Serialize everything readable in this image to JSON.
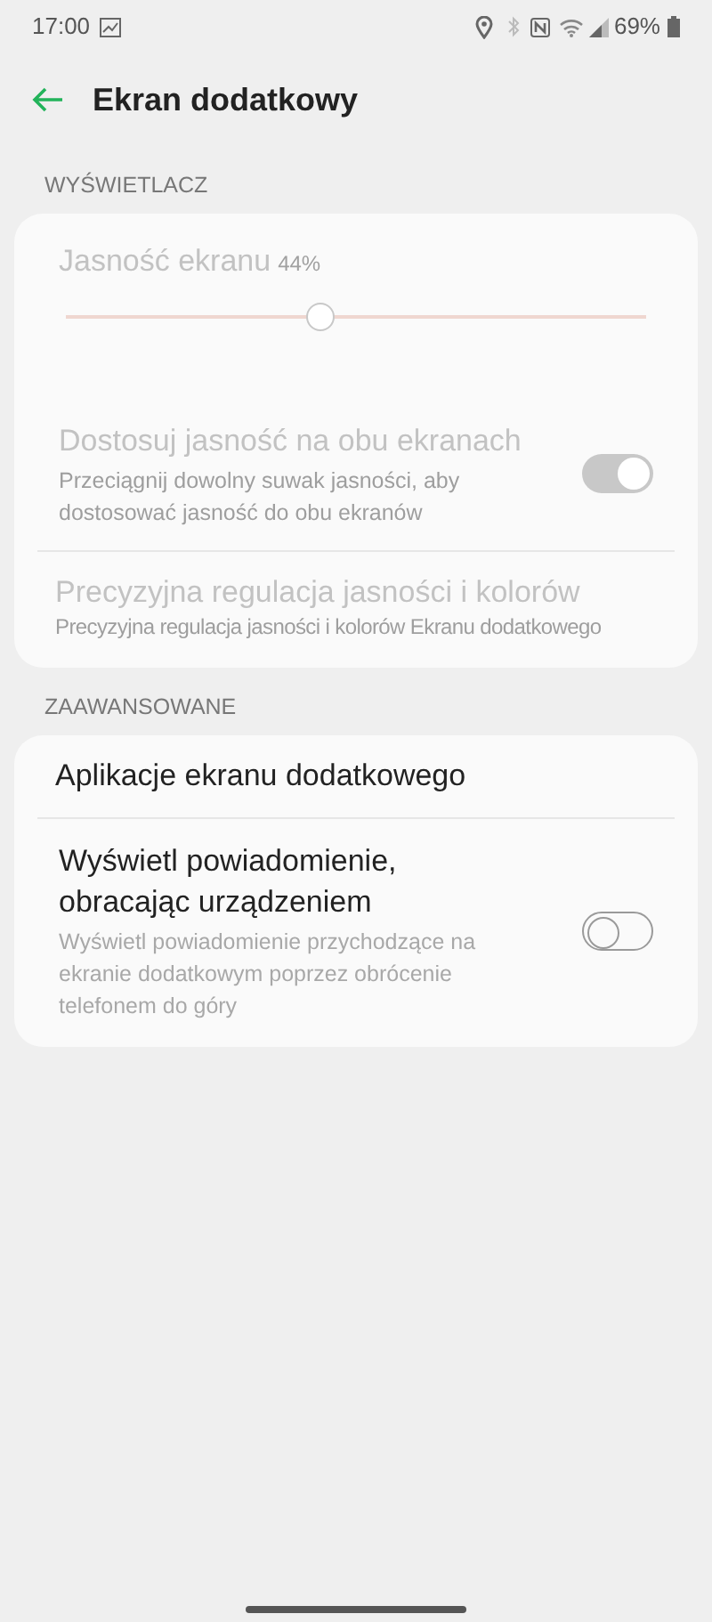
{
  "status_bar": {
    "time": "17:00",
    "battery": "69%"
  },
  "header": {
    "title": "Ekran dodatkowy"
  },
  "sections": [
    {
      "title": "WYŚWIETLACZ",
      "items": [
        {
          "kind": "slider",
          "label": "Jasność ekranu",
          "reading": "44%",
          "level": 0.44,
          "disabled": true
        },
        {
          "kind": "toggle",
          "label": "Dostosuj jasność na obu ekranach",
          "summary": "Przeciągnij dowolny suwak jasności, aby dostosować jasność do obu ekranów",
          "on": true,
          "disabled": true
        },
        {
          "kind": "link",
          "label": "Precyzyjna regulacja jasności i kolorów",
          "summary": "Precyzyjna regulacja jasności i kolorów Ekranu dodatkowego",
          "disabled": true
        }
      ]
    },
    {
      "title": "ZAAWANSOWANE",
      "items": [
        {
          "kind": "link",
          "label": "Aplikacje ekranu dodatkowego",
          "disabled": false
        },
        {
          "kind": "toggle",
          "label": "Wyświetl powiadomienie, obracając urządzeniem",
          "summary": "Wyświetl powiadomienie przychodzące na ekranie dodatkowym poprzez obrócenie telefonem do góry",
          "on": false,
          "disabled": false
        }
      ]
    }
  ]
}
